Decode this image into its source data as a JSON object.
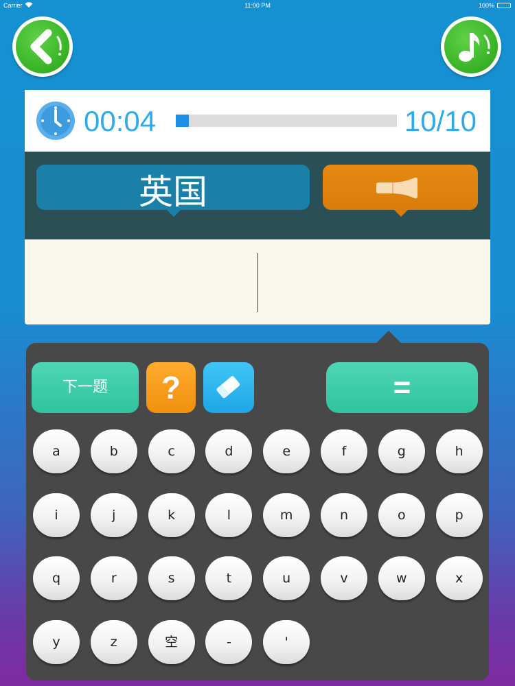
{
  "status_bar": {
    "carrier": "Carrier",
    "time": "11:00 PM",
    "battery": "100%"
  },
  "timer": {
    "elapsed": "00:04",
    "progress_percent": 6,
    "counter": "10/10"
  },
  "question": {
    "word": "英国"
  },
  "controls": {
    "next_label": "下一题",
    "hint_label": "?",
    "equals_label": "="
  },
  "keyboard": {
    "keys": [
      "a",
      "b",
      "c",
      "d",
      "e",
      "f",
      "g",
      "h",
      "i",
      "j",
      "k",
      "l",
      "m",
      "n",
      "o",
      "p",
      "q",
      "r",
      "s",
      "t",
      "u",
      "v",
      "w",
      "x",
      "y",
      "z",
      "空",
      "-",
      "'"
    ]
  },
  "colors": {
    "accent_blue": "#32a9e8",
    "green_button": "#3cb628",
    "teal_button": "#2fc49e",
    "orange_button": "#f0900e",
    "panel_dark": "#484849"
  }
}
